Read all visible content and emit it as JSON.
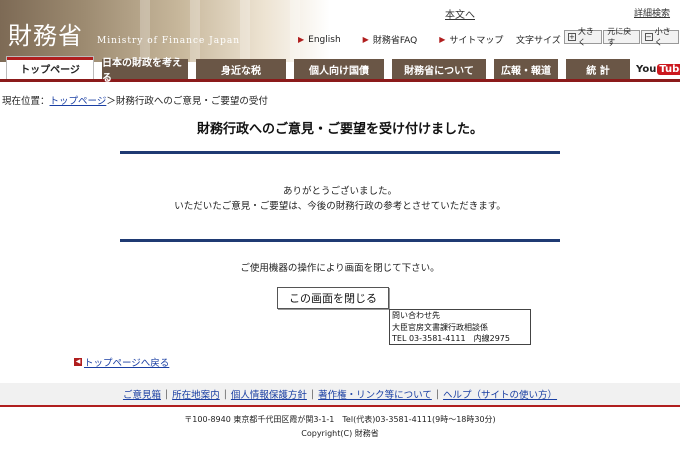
{
  "header": {
    "logo_kanji": "財務省",
    "logo_en": "Ministry of Finance Japan",
    "main_text_link": "本文へ",
    "search_link": "詳細検索",
    "quicklinks": [
      "English",
      "財務省FAQ",
      "サイトマップ"
    ],
    "fontsize_label": "文字サイズ",
    "fontsize_buttons": [
      "大きく",
      "元に戻す",
      "小さく"
    ]
  },
  "nav": {
    "tabs": [
      "トップページ",
      "日本の財政を考える",
      "身近な税",
      "個人向け国債",
      "財務省について",
      "広報・報道",
      "統 計"
    ],
    "youtube_you": "You",
    "youtube_tube": "Tube"
  },
  "breadcrumb": {
    "prefix": "現在位置：",
    "home": "トップページ",
    "sep": "＞",
    "current": "財務行政へのご意見・ご要望の受付"
  },
  "main": {
    "title": "財務行政へのご意見・ご要望を受け付けました。",
    "thanks1": "ありがとうございました。",
    "thanks2": "いただいたご意見・ご要望は、今後の財務行政の参考とさせていただきます。",
    "close_note": "ご使用機器の操作により画面を閉じて下さい。",
    "close_button": "この画面を閉じる",
    "contact_line1": "問い合わせ先",
    "contact_line2": "大臣官房文書課行政相談係",
    "contact_line3": "TEL 03-3581-4111　内線2975",
    "back_link": "トップページへ戻る"
  },
  "footer": {
    "links": [
      "ご意見箱",
      "所在地案内",
      "個人情報保護方針",
      "著作権・リンク等について",
      "ヘルプ（サイトの使い方）"
    ],
    "address": "〒100-8940 東京都千代田区霞が関3-1-1　Tel(代表)03-3581-4111(9時〜18時30分)",
    "copyright": "Copyright(C) 財務省"
  },
  "colors": {
    "accent_red": "#b01e1e",
    "nav_brown": "#6a5646",
    "rule_blue": "#1f3a73",
    "link_blue": "#1a3fa3"
  }
}
